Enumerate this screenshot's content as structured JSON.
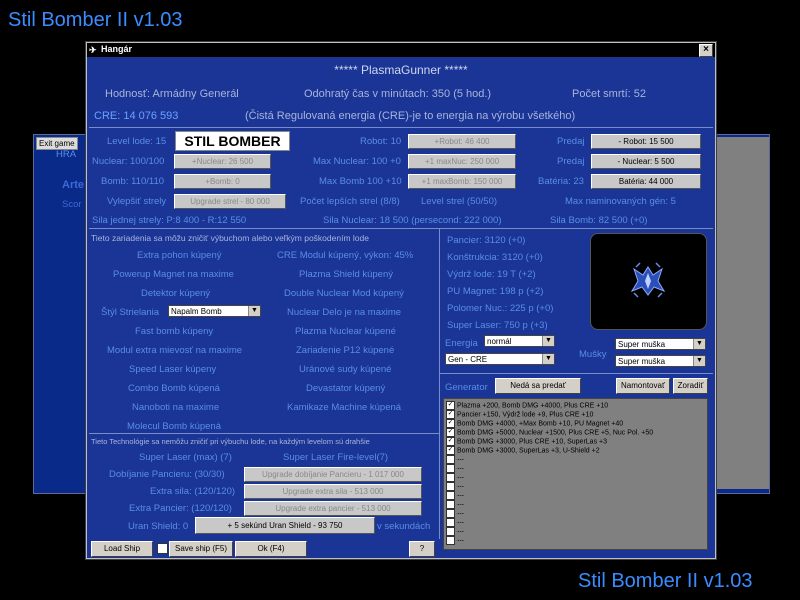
{
  "top_title": "Stil Bomber II v1.03",
  "bottom_title": "Stil Bomber II v1.03",
  "bg_window": {
    "exit_button": "Exit game",
    "hra_label": "HRA",
    "arte_label": "Arte",
    "score_label": "Scor"
  },
  "window": {
    "title": "Hangár",
    "close": "×",
    "player_name": "***** PlasmaGunner *****",
    "rank": "Hodnosť: Armádny Generál",
    "playtime": "Odohratý čas v minútach: 350 (5 hod.)",
    "deaths": "Počet smrtí: 52",
    "cre": "CRE: 14 076 593",
    "cre_desc": "(Čistá Regulovaná energia (CRE)-je to energia na výrobu všetkého)"
  },
  "stats": {
    "level_lode": "Level lode: 15",
    "stil_bomber": "STIL BOMBER",
    "robot": "Robot: 10",
    "robot_btn": "+Robot: 46 400",
    "predaj1": "Predaj",
    "predaj1_btn": "- Robot: 15 500",
    "nuclear": "Nuclear: 100/100",
    "nuclear_btn": "+Nuclear: 26 500",
    "max_nuclear": "Max Nuclear: 100 +0",
    "max_nuclear_btn": "+1 maxNuc: 250 000",
    "predaj2": "Predaj",
    "predaj2_btn": "- Nuclear: 5 500",
    "bomb": "Bomb: 110/110",
    "bomb_btn": "+Bomb: 0",
    "max_bomb": "Max Bomb 100 +10",
    "max_bomb_btn": "+1 maxBomb: 150 000",
    "bateria": "Batéria: 23",
    "bateria_btn": "Batéria: 44 000",
    "vylepsit": "Vylepšiť strely",
    "upgrade_strel_btn": "Upgrade strel - 80 000",
    "pocet_lepsich": "Počet lepších strel (8/8)",
    "level_strel": "Level strel (50/50)",
    "max_naminovanych": "Max naminovaných gén: 5",
    "sila_jednej": "Sila jednej strely: P:8 400 - R:12 550",
    "sila_nuclear": "Sila Nuclear: 18 500 (persecond: 222 000)",
    "sila_bomb": "Sila Bomb: 82 500 (+0)"
  },
  "devices": {
    "header": "Tieto zariadenia sa môžu zničiť výbuchom alebo veľkým poškodením lode",
    "items_left": [
      "Extra pohon kúpený",
      "Powerup Magnet na maxime",
      "Detektor kúpený",
      "Fast bomb kúpeny",
      "Modul extra mievosť na maxime",
      "Speed Laser kúpeny",
      "Combo Bomb kúpená",
      "Nanoboti na maxime",
      "Molecul Bomb kúpená"
    ],
    "items_right": [
      "CRE Modul kúpený, výkon: 45%",
      "Plazma Shield kúpený",
      "Double Nuclear Mod kúpený",
      "Nuclear Delo je na maxime",
      "Plazma Nuclear kúpené",
      "Zariadenie P12 kúpené",
      "Uránové sudy kúpené",
      "Devastator kúpený",
      "Kamikaze Machine kúpená"
    ],
    "styl_label": "Štýl Strielania",
    "styl_value": "Napalm Bomb"
  },
  "tech": {
    "header": "Tieto Technológie sa nemôžu zničiť pri výbuchu lode, na každým levelom sú drahšie",
    "super_laser": "Super Laser (max) (7)",
    "super_laser_fire": "Super Laser Fire-level(7)",
    "dobijanie_label": "Dobíjanie Pancieru: (30/30)",
    "dobijanie_btn": "Upgrade dobíjanie Pancieru - 1 017 000",
    "extra_sila_label": "Extra sila: (120/120)",
    "extra_sila_btn": "Upgrade extra sila - 513 000",
    "extra_pancier_label": "Extra Pancier: (120/120)",
    "extra_pancier_btn": "Upgrade extra pancier - 513 000",
    "uran_label": "Uran Shield: 0",
    "uran_btn": "+ 5 sekúnd Uran Shield - 93 750",
    "v_sekundach": "v sekundách"
  },
  "ship_stats": {
    "items": [
      "Pancier: 3120 (+0)",
      "Konštrukcia: 3120 (+0)",
      "Výdrž lode: 19 T (+2)",
      "PU Magnet: 198 p (+2)",
      "Polomer Nuc.: 225 p (+0)",
      "Super Laser: 750 p (+3)"
    ]
  },
  "energia": {
    "label": "Energia",
    "select1": "normál",
    "select2": "Gen - CRE"
  },
  "musky": {
    "label": "Mušky",
    "select1": "Super muška",
    "select2": "Super muška"
  },
  "generator": {
    "label": "Generator",
    "neda_btn": "Nedá sa predať",
    "namontovat_btn": "Namontovať",
    "zoradit_btn": "Zoradiť",
    "items": [
      "Plazma +200, Bomb DMG +4000, Plus CRE +10",
      "Pancier +150, Výdrž lode +9, Plus CRE +10",
      "Bomb DMG +4000, +Max Bomb +10, PU Magnet +40",
      "Bomb DMG +5000, Nuclear +1500, Plus CRE +5, Nuc Pol. +50",
      "Bomb DMG +3000, Plus CRE +10, SuperLas +3",
      "Bomb DMG +3000, SuperLas +3, U-Shield +2",
      "---",
      "---",
      "---",
      "---",
      "---",
      "---",
      "---",
      "---",
      "---",
      "---"
    ]
  },
  "bottom_buttons": {
    "load": "Load Ship",
    "save": "Save ship (F5)",
    "ok": "Ok (F4)",
    "help": "?"
  }
}
